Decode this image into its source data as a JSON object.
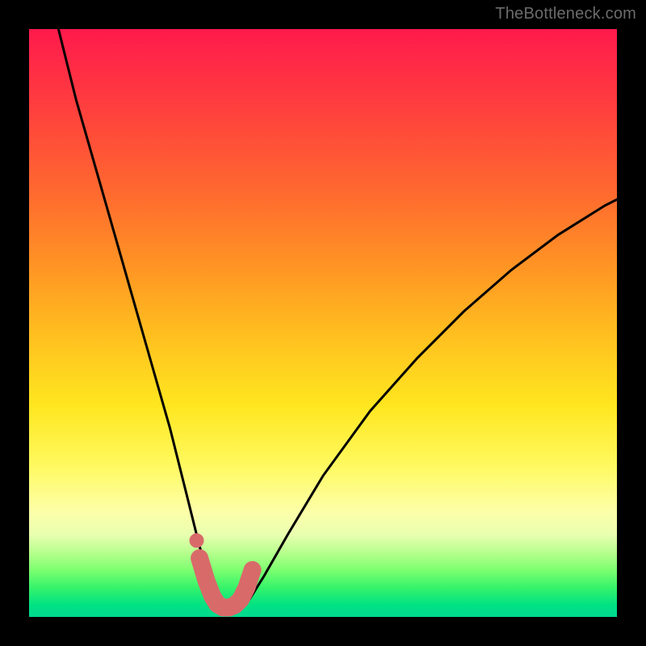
{
  "watermark": {
    "text": "TheBottleneck.com"
  },
  "colors": {
    "background": "#000000",
    "curve_stroke": "#000000",
    "overlay_pink": "#d96a6a",
    "gradient_stops": [
      "#ff1a4c",
      "#ff3b3f",
      "#ff6a2f",
      "#ff9324",
      "#ffbf1f",
      "#ffe61f",
      "#fff95e",
      "#fdffa8",
      "#e9ffb0",
      "#b8ff8e",
      "#7dff70",
      "#36f36a",
      "#00e283",
      "#00d98f"
    ]
  },
  "chart_data": {
    "type": "line",
    "title": "",
    "xlabel": "",
    "ylabel": "",
    "xlim": [
      0,
      100
    ],
    "ylim": [
      0,
      100
    ],
    "series": [
      {
        "name": "bottleneck-curve",
        "x": [
          5,
          8,
          12,
          16,
          20,
          24,
          27,
          29,
          30.5,
          32,
          33,
          34,
          35,
          36,
          37.5,
          40,
          44,
          50,
          58,
          66,
          74,
          82,
          90,
          98,
          100
        ],
        "y": [
          100,
          88,
          74,
          60,
          46,
          32,
          20,
          12,
          7,
          3.5,
          1.8,
          1.2,
          1.2,
          1.6,
          3,
          7,
          14,
          24,
          35,
          44,
          52,
          59,
          65,
          70,
          71
        ]
      }
    ],
    "overlay": {
      "name": "highlight-band",
      "x": [
        29,
        30.2,
        31.2,
        32,
        33,
        34,
        35,
        36,
        37,
        38
      ],
      "y": [
        10,
        6,
        3.5,
        2.2,
        1.6,
        1.6,
        2,
        3,
        5,
        8
      ]
    },
    "overlay_dot": {
      "x": 28.5,
      "y": 13
    }
  }
}
